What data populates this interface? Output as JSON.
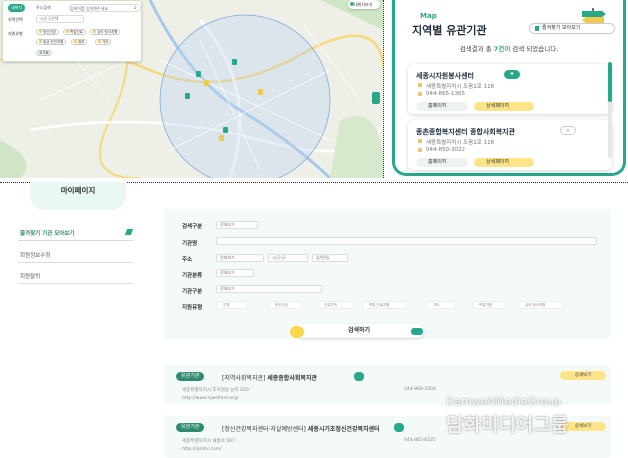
{
  "map_panel": {
    "tabs": [
      "내위치",
      "주소검색"
    ],
    "search_placeholder": "검색어를 입력해주세요",
    "region_label": "지역선택",
    "region_value": "시군구선택",
    "category_label": "지원유형",
    "categories": [
      "정신건강",
      "학업진로",
      "심리·정서지원",
      "일상·안전지원",
      "정보",
      "기타"
    ],
    "reset_label": "초기화",
    "top_button": "내위치보기"
  },
  "right_panel": {
    "map_label": "Map",
    "title": "지역별 유관기관",
    "favorites_button": "즐겨찾기 모아보기",
    "result_prefix": "검색결과 총 ",
    "result_count": "7건",
    "result_suffix": "이 검색 되었습니다.",
    "cards": [
      {
        "name": "세종시자원봉사센터",
        "address": "세종특별자치시 도움1로 116",
        "phone": "044-865-1365",
        "home_label": "홈페이지",
        "detail_label": "상세페이지"
      },
      {
        "name": "종촌종합복지센터 종합사회복지관",
        "address": "세종특별자치시 도움1로 116",
        "phone": "044-850-3022",
        "home_label": "홈페이지",
        "detail_label": "상세페이지"
      }
    ]
  },
  "mypage": {
    "title": "마이페이지",
    "side_items": [
      "즐겨찾기 기관 모아보기",
      "회원정보수정",
      "회원탈퇴"
    ],
    "form": {
      "labels": [
        "검색구분",
        "기관명",
        "주소",
        "기관분류",
        "기관구분",
        "지원유형"
      ],
      "search_type": "전체보기",
      "addr_selects": [
        "전체보기",
        "시/군/구",
        "읍/면/동"
      ],
      "org_class": "전체보기",
      "org_type": "전체보기",
      "support_types": [
        "전체",
        "정신건강",
        "진로진학",
        "학업·진로지원",
        "기타",
        "학업지원",
        "심리·정서지원"
      ],
      "search_button": "검색하기"
    },
    "results": [
      {
        "tag": "유관기관",
        "category": "[지역사회복지관]",
        "name": "세종종합사회복지관",
        "addr": "세종특별자치시 조치원읍 남리 420",
        "url": "http://www.sjwelfare.org/",
        "phone": "044-868-2004",
        "detail": "상세보기"
      },
      {
        "tag": "유관기관",
        "category": "[정신건강복지센터·자살예방센터]",
        "name": "세종시기초정신건강복지센터",
        "addr": "세종특별자치시 새롬북 567",
        "url": "http://sjmhc.com/",
        "phone": "044-865-6225",
        "detail": "상세보기"
      }
    ]
  },
  "watermark": {
    "en": "DamwahMediaGroup",
    "ko": "담화미디어그룹"
  }
}
